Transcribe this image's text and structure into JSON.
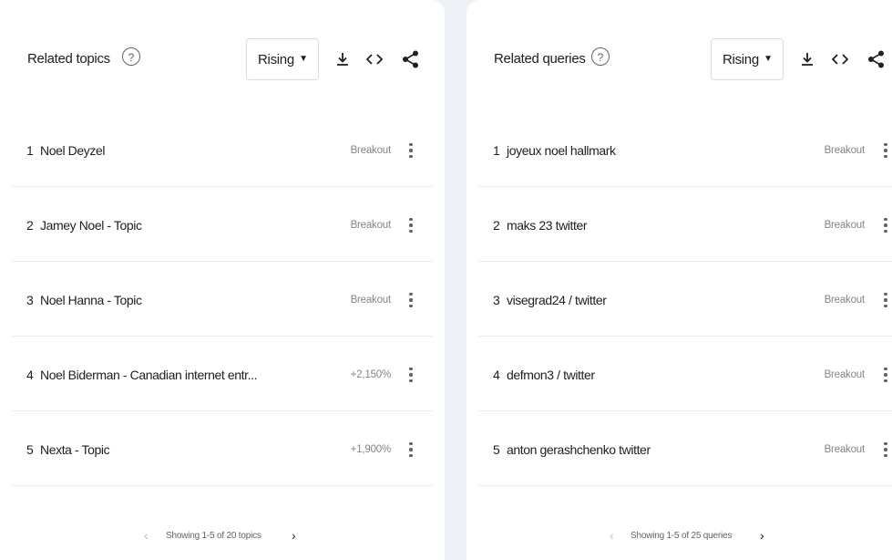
{
  "left": {
    "title": "Related topics",
    "help": "?",
    "filter": "Rising",
    "rows": [
      {
        "index": "1",
        "label": "Noel Deyzel",
        "value": "Breakout"
      },
      {
        "index": "2",
        "label": "Jamey Noel - Topic",
        "value": "Breakout"
      },
      {
        "index": "3",
        "label": "Noel Hanna - Topic",
        "value": "Breakout"
      },
      {
        "index": "4",
        "label": "Noel Biderman - Canadian internet entr...",
        "value": "+2,150%"
      },
      {
        "index": "5",
        "label": "Nexta - Topic",
        "value": "+1,900%"
      }
    ],
    "pager": "Showing 1-5 of 20 topics"
  },
  "right": {
    "title": "Related queries",
    "help": "?",
    "filter": "Rising",
    "rows": [
      {
        "index": "1",
        "label": "joyeux noel hallmark",
        "value": "Breakout"
      },
      {
        "index": "2",
        "label": "maks 23 twitter",
        "value": "Breakout"
      },
      {
        "index": "3",
        "label": "visegrad24 / twitter",
        "value": "Breakout"
      },
      {
        "index": "4",
        "label": "defmon3 / twitter",
        "value": "Breakout"
      },
      {
        "index": "5",
        "label": "anton gerashchenko twitter",
        "value": "Breakout"
      }
    ],
    "pager": "Showing 1-5 of 25 queries"
  },
  "icons": {
    "download": "download-icon",
    "embed": "embed-code-icon",
    "share": "share-icon",
    "help": "help-circle-icon",
    "menu": "more-vertical-icon",
    "prev": "chevron-left-icon",
    "next": "chevron-right-icon"
  },
  "colors": {
    "text": "#202124",
    "muted": "#80868b",
    "divider": "#e8eaed",
    "background": "#eef1f6"
  }
}
